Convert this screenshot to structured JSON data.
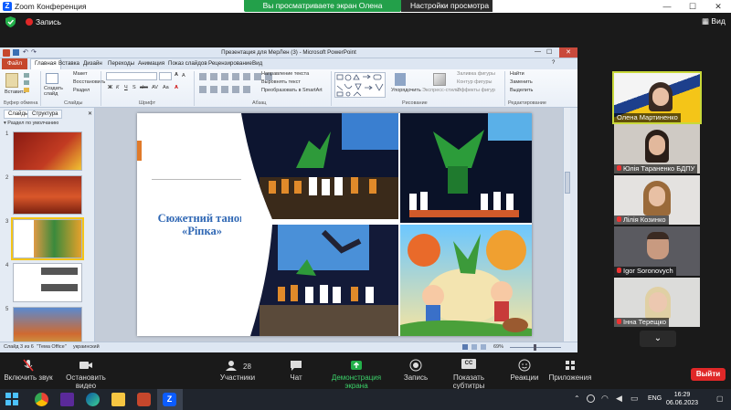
{
  "zoom": {
    "window_title": "Zoom Конференция",
    "recording_label": "Запись",
    "view_label": "Вид",
    "share_banner": "Вы просматриваете экран Олена Мартиненко",
    "view_options": "Настройки просмотра",
    "controls": {
      "audio": "Включить звук",
      "video": "Остановить видео",
      "participants": "Участники",
      "participants_count": "28",
      "chat": "Чат",
      "share": "Демонстрация экрана",
      "record": "Запись",
      "cc_badge": "CC",
      "captions": "Показать субтитры",
      "reactions": "Реакции",
      "apps": "Приложения",
      "leave": "Выйти"
    },
    "participants": [
      {
        "name": "Олена Мартиненко",
        "active": true
      },
      {
        "name": "Юлія Тараненко БДПУ"
      },
      {
        "name": "Лілія Козинко"
      },
      {
        "name": "Igor Soronovych"
      },
      {
        "name": "Інна Терещко"
      }
    ]
  },
  "ppt": {
    "title": "Презентация для МерЛен (3) - Microsoft PowerPoint",
    "tabs": [
      "Файл",
      "Главная",
      "Вставка",
      "Дизайн",
      "Переходы",
      "Анимация",
      "Показ слайдов",
      "Рецензирование",
      "Вид"
    ],
    "active_tab": "Главная",
    "ribbon": {
      "paste": "Вставить",
      "create_slide": "Создать слайд",
      "layout": "Макет",
      "reset": "Восстановить",
      "section": "Раздел",
      "clipboard": "Буфер обмена",
      "slides": "Слайды",
      "font": "Шрифт",
      "paragraph": "Абзац",
      "text_direction": "Направление текста",
      "align_text": "Выровнять текст",
      "smartart": "Преобразовать в SmartArt",
      "arrange": "Упорядочить",
      "quick_styles": "Экспресс-стили",
      "shape_fill": "Заливка фигуры",
      "shape_outline": "Контур фигуры",
      "shape_effects": "Эффекты фигур",
      "drawing": "Рисование",
      "find": "Найти",
      "replace": "Заменить",
      "select": "Выделить",
      "editing": "Редактирование",
      "font_size_up": "A",
      "font_size_down": "A",
      "bold": "Ж",
      "italic": "К",
      "underline": "Ч",
      "strike": "S",
      "shadow": "abc",
      "spacing": "AV",
      "case": "Aa",
      "font_color": "A"
    },
    "left_tabs": [
      "Слайды",
      "Структура"
    ],
    "section_label": "Раздел по умолчанию",
    "slide_numbers": [
      "1",
      "2",
      "3",
      "4",
      "5"
    ],
    "slide_title_line1": "Сюжетний танок",
    "slide_title_line2": "«Ріпка»",
    "status": {
      "slide": "Слайд 3 из 6",
      "theme": "\"Тема Office\"",
      "lang": "украинский",
      "zoom": "69%"
    }
  },
  "taskbar": {
    "time": "16:29",
    "date": "06.06.2023",
    "lang": "ENG"
  }
}
